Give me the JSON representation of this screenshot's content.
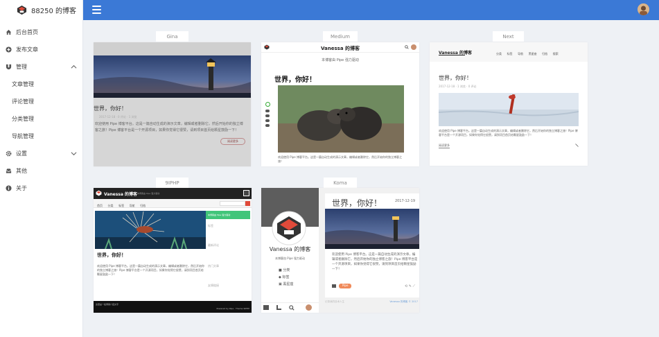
{
  "app": {
    "title": "88250 的博客"
  },
  "sidebar": {
    "items": [
      {
        "label": "后台首页",
        "icon": "home-icon"
      },
      {
        "label": "发布文章",
        "icon": "plus-circle-icon"
      },
      {
        "label": "管理",
        "icon": "magnet-icon",
        "expanded": true
      },
      {
        "label": "文章管理"
      },
      {
        "label": "评论管理"
      },
      {
        "label": "分类管理"
      },
      {
        "label": "导航管理"
      },
      {
        "label": "设置",
        "icon": "gear-icon",
        "expanded": false
      },
      {
        "label": "其他",
        "icon": "inbox-icon"
      },
      {
        "label": "关于",
        "icon": "info-circle-icon"
      }
    ]
  },
  "themes": {
    "gina": {
      "name": "Gina",
      "post_title": "世界，你好！",
      "post_meta": "2017-12-18 · 0 评论 · 1 浏览",
      "post_excerpt": "欢迎使用 Pipe 博客平台。这是一篇自动生成的演示文章，编辑或者删除它，然后开始你的独立博客之旅！Pipe 博客平台是一个开源项目，如果你觉得它很赞，请到项目首页给颗星鼓励一下！",
      "read_more": "阅读更多"
    },
    "medium": {
      "name": "Medium",
      "blog_name": "Vanessa 的博客",
      "powered": "本博客由 Pipe 强力驱动",
      "post_title": "世界，你好！",
      "post_excerpt": "欢迎使用 Pipe 博客平台。这是一篇自动生成的演示文章，编辑或者删除它，然后开始你的独立博客之旅！"
    },
    "next": {
      "name": "Next",
      "blog_name": "Vanessa 的博客",
      "nav": [
        "分类",
        "标签",
        "导航",
        "黑星座",
        "归档",
        "搜索"
      ],
      "post_title": "世界，你好！",
      "post_meta": "2017-12-18 · 1 浏览 · 0 评论",
      "post_excerpt": "欢迎使用 Pipe 博客平台。这是一篇自动生成的演示文章，编辑或者删除它，然后开始你的独立博客之旅！Pipe 博客平台是一个开源项目，如果你觉得它很赞，请到项目首页给颗星鼓励一下！",
      "read_more": "阅读更多"
    },
    "ninephp": {
      "name": "9IPHP",
      "blog_name": "Vanessa 的博客",
      "tagline": "本博客由 Pipe 强力驱动",
      "nav": [
        "首页",
        "分类",
        "标签",
        "导航",
        "归档"
      ],
      "post_title": "世界，你好！",
      "post_excerpt": "欢迎使用 Pipe 博客平台。这是一篇自动生成的演示文章，编辑或者删除它，然后开始你的独立博客之旅！Pipe 博客平台是一个开源项目，如果你觉得它很赞，请到项目首页给颗星鼓励一下！",
      "sidebar_head": "本博客由 Pipe 强力驱动",
      "side_sections": [
        "标签",
        "最新评论",
        "热门文章",
        "友情链接"
      ],
      "footer_left": "这里是一段博客介绍文字",
      "footer_right": "Powered by Pipe · Theme 9IPHP"
    },
    "koma": {
      "name": "Koma",
      "blog_name": "Vanessa 的博客",
      "powered": "本博客由 Pipe 强力驱动",
      "menu": [
        "分类",
        "标签",
        "黑星座"
      ],
      "post_title": "世界，你好！",
      "post_date": "2017-12-19",
      "post_excerpt": "欢迎使用 Pipe 博客平台。这是一篇自动生成的演示文章，编辑或者删除它，然后开始你的独立博客之旅！Pipe 博客平台是一个开源项目，如果你觉得它很赞，请到项目首页给颗星鼓励一下！",
      "tag": "Pipe",
      "footer_left": "记录我的技术人生",
      "footer_right": "Vanessa 的博客 © 2017"
    }
  },
  "colors": {
    "topbar": "#3b79d6",
    "sidebar_bg": "#ffffff",
    "page_bg": "#eef1f5",
    "green": "#41c57a",
    "red": "#e04a3a"
  }
}
